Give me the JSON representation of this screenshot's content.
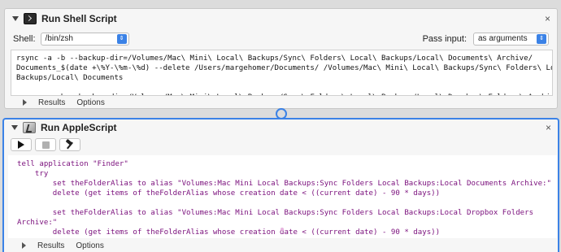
{
  "shell_action": {
    "title": "Run Shell Script",
    "close_glyph": "×",
    "shell_label": "Shell:",
    "shell_value": "/bin/zsh",
    "pass_label": "Pass input:",
    "pass_value": "as arguments",
    "code": "rsync -a -b --backup-dir=/Volumes/Mac\\ Mini\\ Local\\ Backups/Sync\\ Folders\\ Local\\ Backups/Local\\ Documents\\ Archive/\nDocuments_$(date +\\%Y-\\%m-\\%d) --delete /Users/margehomer/Documents/ /Volumes/Mac\\ Mini\\ Local\\ Backups/Sync\\ Folders\\ Local\\\nBackups/Local\\ Documents\n\nrsync -a -b --backup-dir=/Volumes/Mac\\ Mini\\ Local\\ Backups/Sync\\ Folders\\ Local\\ Backups/Local\\ Dropbox\\ Folders\\ Archive/",
    "footer": {
      "results": "Results",
      "options": "Options"
    }
  },
  "apple_action": {
    "title": "Run AppleScript",
    "close_glyph": "×",
    "code": "tell application \"Finder\"\n    try\n        set theFolderAlias to alias \"Volumes:Mac Mini Local Backups:Sync Folders Local Backups:Local Documents Archive:\"\n        delete (get items of theFolderAlias whose creation date < ((current date) - 90 * days))\n\n        set theFolderAlias to alias \"Volumes:Mac Mini Local Backups:Sync Folders Local Backups:Local Dropbox Folders\nArchive:\"\n        delete (get items of theFolderAlias whose creation date < ((current date) - 90 * days))",
    "footer": {
      "results": "Results",
      "options": "Options"
    }
  },
  "icons": {
    "shell": "terminal-icon",
    "apple": "script-editor-icon",
    "run": "play-icon",
    "stop": "stop-icon",
    "compile": "hammer-icon"
  },
  "colors": {
    "accent": "#3b82e6",
    "applescript_text": "#7a0f7c",
    "panel_bg": "#f6f6f6"
  }
}
